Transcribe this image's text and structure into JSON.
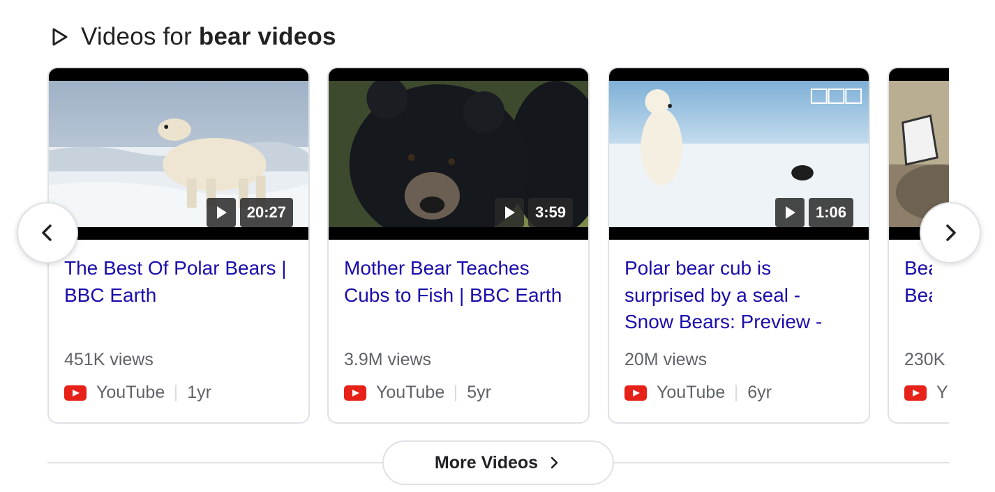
{
  "header": {
    "prefix": "Videos for ",
    "query": "bear videos"
  },
  "cards": [
    {
      "title": "The Best Of Polar Bears | BBC Earth",
      "duration": "20:27",
      "views": "451K views",
      "source": "YouTube",
      "age": "1yr"
    },
    {
      "title": "Mother Bear Teaches Cubs to Fish | BBC Earth",
      "duration": "3:59",
      "views": "3.9M views",
      "source": "YouTube",
      "age": "5yr"
    },
    {
      "title": "Polar bear cub is surprised by a seal - Snow Bears: Preview -",
      "duration": "1:06",
      "views": "20M views",
      "source": "YouTube",
      "age": "6yr"
    },
    {
      "title": "Bear Bear",
      "duration": "",
      "views": "230K",
      "source": "Y",
      "age": ""
    }
  ],
  "more_button": {
    "label": "More Videos"
  },
  "thumbnail_watermark": "BBC",
  "colors": {
    "link": "#1a0dab",
    "meta": "#5f6368",
    "youtube_red": "#e62117",
    "border": "#dfe1e5"
  },
  "icons": {
    "header": "play-outline-icon",
    "prev": "chevron-left-icon",
    "next": "chevron-right-icon",
    "more": "chevron-right-icon",
    "source": "youtube-icon",
    "duration": "play-icon"
  }
}
